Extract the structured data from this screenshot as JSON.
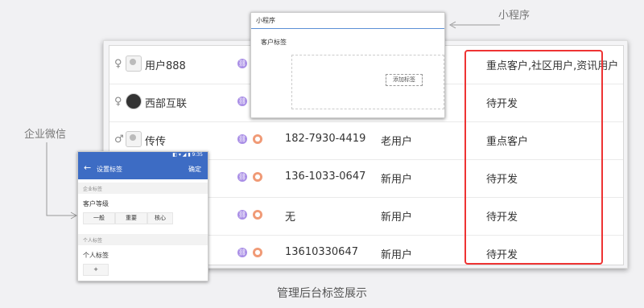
{
  "labels": {
    "mini_program": "小程序",
    "wecom": "企业微信",
    "caption": "管理后台标签展示"
  },
  "rows": [
    {
      "gender": "♀",
      "name": "用户888",
      "phone": "",
      "user_type": "",
      "tag": "重点客户,社区用户,资讯用户",
      "has_contact_icon": false
    },
    {
      "gender": "♀",
      "name": "西部互联",
      "phone": "",
      "user_type": "",
      "tag": "待开发",
      "has_contact_icon": false
    },
    {
      "gender": "♂",
      "name": "传传",
      "phone": "182-7930-4419",
      "user_type": "老用户",
      "tag": "重点客户",
      "has_contact_icon": true
    },
    {
      "gender": "",
      "name": "",
      "phone": "136-1033-0647",
      "user_type": "新用户",
      "tag": "待开发",
      "has_contact_icon": true
    },
    {
      "gender": "",
      "name": "",
      "phone": "无",
      "user_type": "新用户",
      "tag": "待开发",
      "has_contact_icon": true
    },
    {
      "gender": "",
      "name": "",
      "phone": "13610330647",
      "user_type": "新用户",
      "tag": "待开发",
      "has_contact_icon": true
    }
  ],
  "mini_program_panel": {
    "tab": "小程序",
    "field_label": "客户标签",
    "add_button": "添加标签"
  },
  "wecom_panel": {
    "status_text": "◧ ▾ ◢ ▮ 9:35",
    "title": "设置标签",
    "confirm": "确定",
    "back_icon": "←",
    "section_enterprise": "企业标签",
    "group_level": "客户等级",
    "chips": [
      "一般",
      "重要",
      "核心"
    ],
    "section_personal": "个人标签",
    "group_personal": "个人标签",
    "add_chip": "+"
  },
  "colors": {
    "highlight_border": "#e33333",
    "header_blue": "#3d6cc4",
    "icon_purple": "#a98ee6",
    "icon_orange": "#f09a76"
  }
}
